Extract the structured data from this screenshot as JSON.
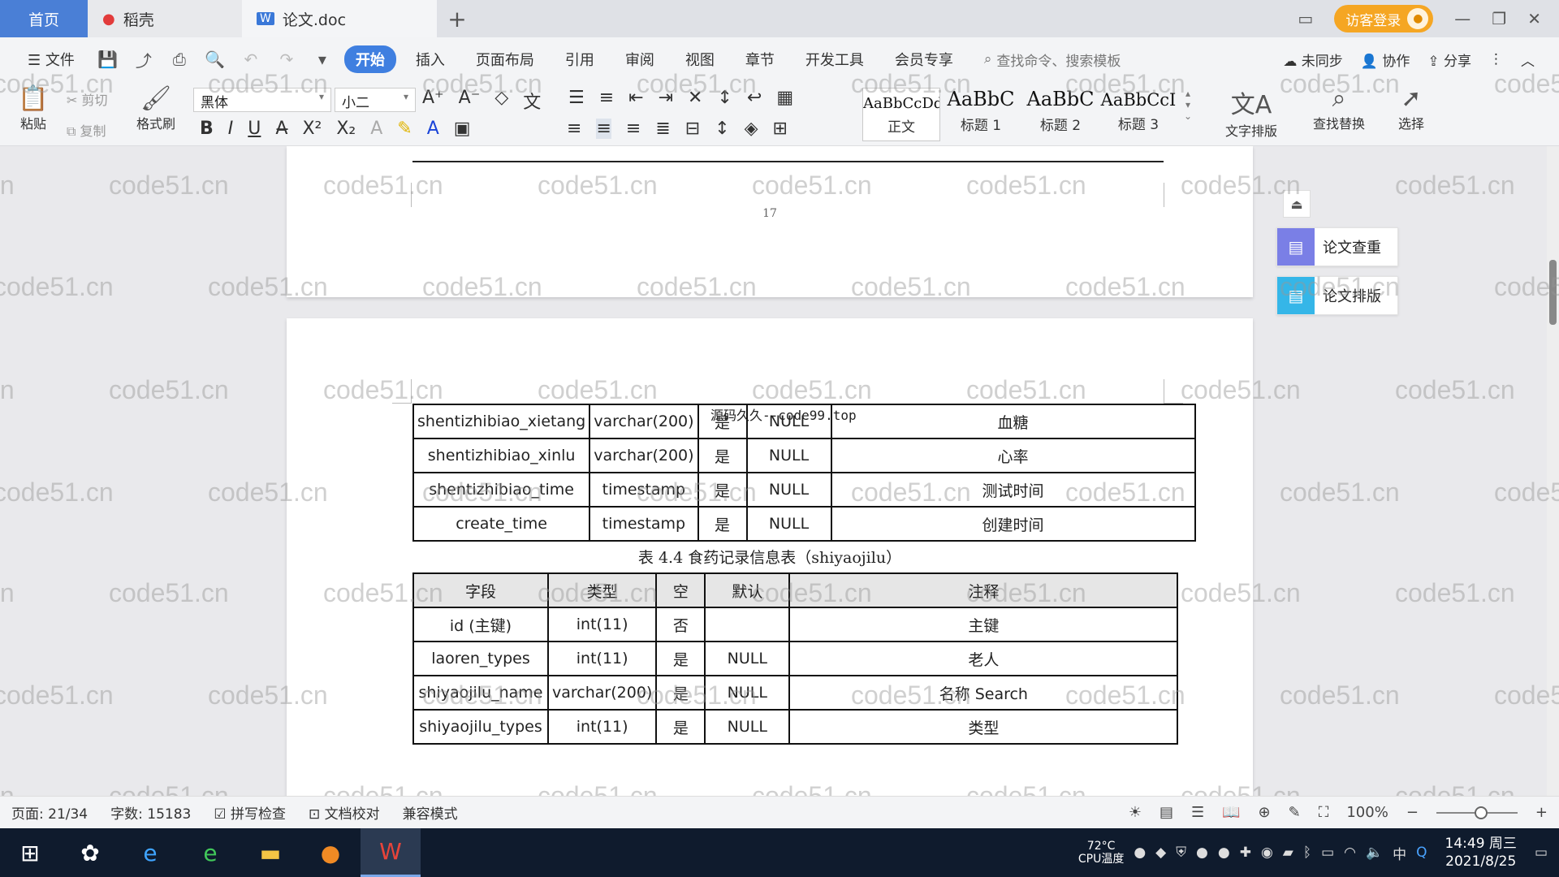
{
  "titlebar": {
    "tabs": [
      {
        "label": "首页"
      },
      {
        "label": "稻壳"
      },
      {
        "label": "论文.doc"
      }
    ],
    "add_tab": "+",
    "guest_login": "访客登录"
  },
  "menubar": {
    "file": "文件",
    "items": [
      "开始",
      "插入",
      "页面布局",
      "引用",
      "审阅",
      "视图",
      "章节",
      "开发工具",
      "会员专享"
    ],
    "search_placeholder": "查找命令、搜索模板",
    "right": {
      "sync": "未同步",
      "collab": "协作",
      "share": "分享"
    }
  },
  "ribbon": {
    "paste": "粘贴",
    "cut": "剪切",
    "copy": "复制",
    "format_painter": "格式刷",
    "font": "黑体",
    "font_size": "小二",
    "styles": [
      {
        "sample": "AaBbCcDd",
        "label": "正文"
      },
      {
        "sample": "AaBbC",
        "label": "标题 1"
      },
      {
        "sample": "AaBbC",
        "label": "标题 2"
      },
      {
        "sample": "AaBbCcI",
        "label": "标题 3"
      }
    ],
    "text_layout": "文字排版",
    "find_replace": "查找替换",
    "select": "选择"
  },
  "document": {
    "page_number": "17",
    "overlay_text": "源码久久--code99.top",
    "table_top": {
      "rows": [
        [
          "shentizhibiao_xietang",
          "varchar(200)",
          "是",
          "NULL",
          "血糖"
        ],
        [
          "shentizhibiao_xinlu",
          "varchar(200)",
          "是",
          "NULL",
          "心率"
        ],
        [
          "shentizhibiao_time",
          "timestamp",
          "是",
          "NULL",
          "测试时间"
        ],
        [
          "create_time",
          "timestamp",
          "是",
          "NULL",
          "创建时间"
        ]
      ]
    },
    "table_caption": "表 4.4 食药记录信息表（shiyaojilu）",
    "table_main": {
      "headers": [
        "字段",
        "类型",
        "空",
        "默认",
        "注释"
      ],
      "rows": [
        [
          "id (主键)",
          "int(11)",
          "否",
          "",
          "主键"
        ],
        [
          "laoren_types",
          "int(11)",
          "是",
          "NULL",
          "老人"
        ],
        [
          "shiyaojilu_name",
          "varchar(200)",
          "是",
          "NULL",
          "名称  Search"
        ],
        [
          "shiyaojilu_types",
          "int(11)",
          "是",
          "NULL",
          "类型"
        ]
      ]
    }
  },
  "side_panel": {
    "check": "论文查重",
    "format": "论文排版"
  },
  "watermark": "code51.cn",
  "statusbar": {
    "page": "页面: 21/34",
    "words": "字数: 15183",
    "spell": "拼写检查",
    "proof": "文档校对",
    "compat": "兼容模式",
    "zoom": "100%",
    "zoom_level": 0.55
  },
  "taskbar": {
    "temp": "72°C",
    "temp_label": "CPU温度",
    "time": "14:49 周三",
    "date": "2021/8/25",
    "ime": "中"
  },
  "colors": {
    "accent": "#3f7fe0",
    "home_tab": "#4a7fd6",
    "guest": "#f5a623",
    "taskbar": "#0f1b2d"
  }
}
